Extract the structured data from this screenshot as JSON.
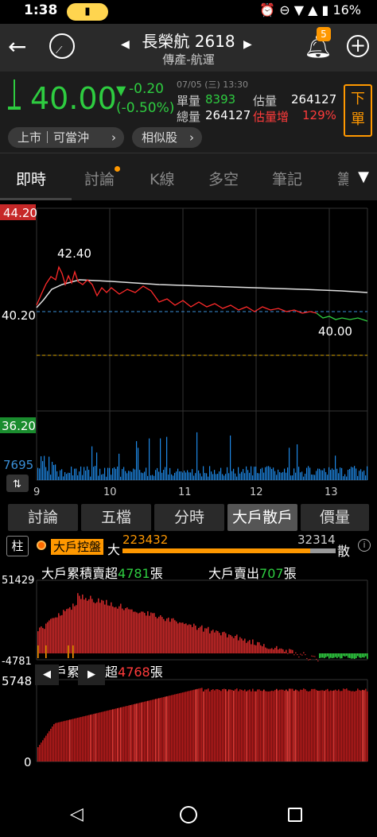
{
  "status": {
    "time": "1:38",
    "battery": "16%"
  },
  "header": {
    "title": "長榮航 2618",
    "subtitle": "傳產-航運",
    "notif_count": "5"
  },
  "quote": {
    "price": "40.00",
    "change": "-0.20",
    "change_pct": "(-0.50%)",
    "datetime": "07/05 (三) 13:30",
    "unit_vol_label": "單量",
    "unit_vol": "8393",
    "est_vol_label": "估量",
    "est_vol": "264127",
    "total_vol_label": "總量",
    "total_vol": "264127",
    "est_inc_label": "估量增",
    "est_inc": "129%",
    "order_button": "下單",
    "market_pill": "上市｜可當沖",
    "similar_pill": "相似股"
  },
  "tabs": [
    "即時",
    "討論",
    "K線",
    "多空",
    "筆記",
    "籌"
  ],
  "chart1": {
    "y_top": "44.20",
    "y_mid": "40.20",
    "high_label": "42.40",
    "last_label": "40.00",
    "vol_top": "36.20",
    "vol_value": "7695",
    "x_labels": [
      "9",
      "10",
      "11",
      "12",
      "13"
    ]
  },
  "subtabs": [
    "討論",
    "五檔",
    "分時",
    "大戶散戶",
    "價量"
  ],
  "big_panel": {
    "column_toggle": "柱",
    "control_label": "大戶控盤",
    "big_label": "大",
    "big_value": "223432",
    "small_value": "32314",
    "small_label": "散",
    "cum_sell_prefix": "大戶累積賣超",
    "cum_sell_value": "4781",
    "cum_sell_unit": "張",
    "big_sell_prefix": "大戶賣出",
    "big_sell_value": "707",
    "big_sell_unit": "張",
    "y_top1": "51429",
    "y_bot1": "-4781",
    "retail_prefix": "散戶累積買超",
    "retail_value": "4768",
    "retail_unit": "張",
    "y_top2": "5748",
    "y_bot2": "0"
  },
  "colors": {
    "up": "#ff3b3b",
    "down": "#2ecc40",
    "accent": "#ff9800"
  }
}
